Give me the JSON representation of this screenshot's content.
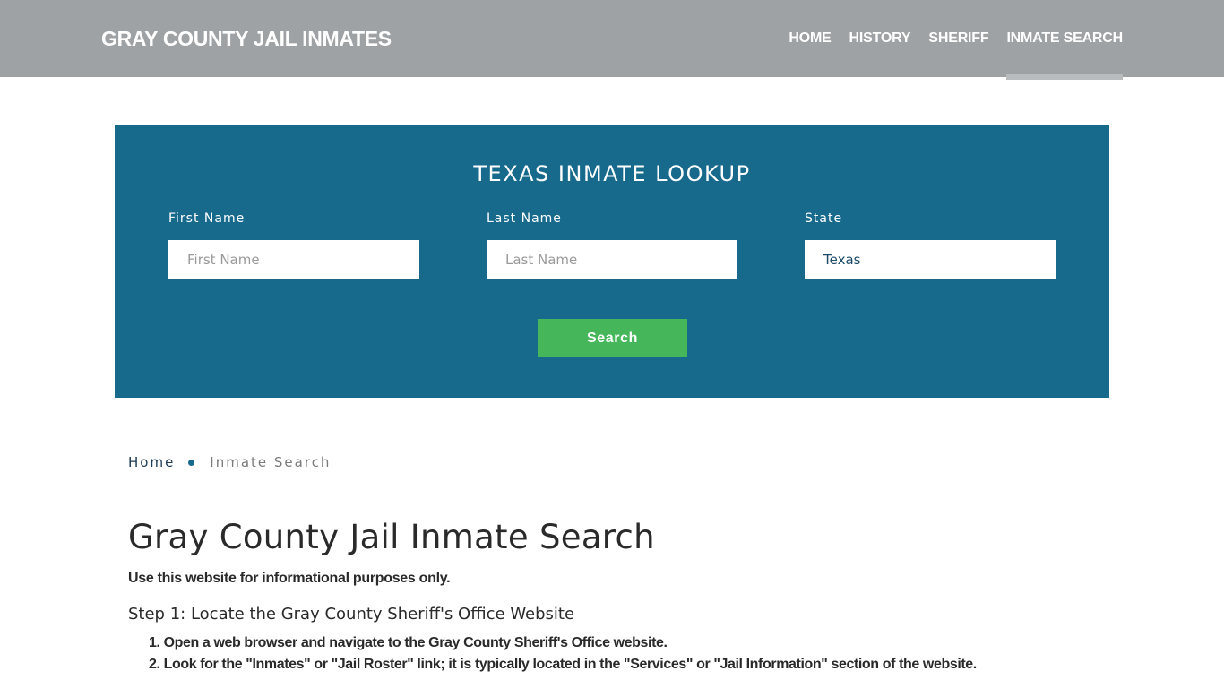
{
  "header": {
    "brand": "GRAY COUNTY JAIL INMATES",
    "nav": [
      {
        "label": "HOME",
        "active": false
      },
      {
        "label": "HISTORY",
        "active": false
      },
      {
        "label": "SHERIFF",
        "active": false
      },
      {
        "label": "INMATE SEARCH",
        "active": true
      }
    ]
  },
  "lookup": {
    "title": "TEXAS INMATE LOOKUP",
    "first_name": {
      "label": "First Name",
      "placeholder": "First Name",
      "value": ""
    },
    "last_name": {
      "label": "Last Name",
      "placeholder": "Last Name",
      "value": ""
    },
    "state": {
      "label": "State",
      "value": "Texas"
    },
    "search_label": "Search",
    "colors": {
      "panel": "#186a8d",
      "button": "#45b75a"
    }
  },
  "breadcrumb": {
    "home": "Home",
    "current": "Inmate Search"
  },
  "content": {
    "title": "Gray County Jail Inmate Search",
    "disclaimer": "Use this website for informational purposes only.",
    "step1_heading": "Step 1: Locate the Gray County Sheriff's Office Website",
    "step1_items": [
      "1. Open a web browser and navigate to the Gray County Sheriff's Office website.",
      "2. Look for the \"Inmates\" or \"Jail Roster\" link; it is typically located in the \"Services\" or \"Jail Information\" section of the website."
    ]
  }
}
